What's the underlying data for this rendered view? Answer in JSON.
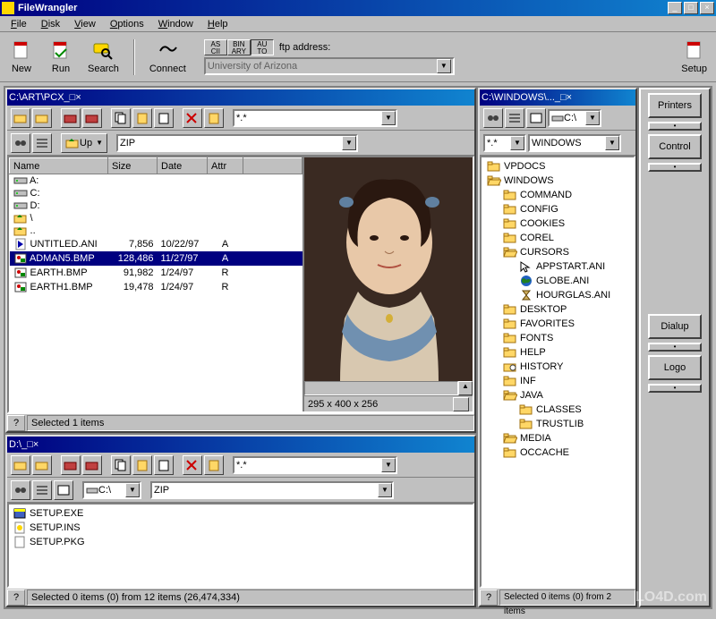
{
  "app": {
    "title": "FileWrangler"
  },
  "menu": [
    "File",
    "Disk",
    "View",
    "Options",
    "Window",
    "Help"
  ],
  "toolbar": {
    "new": "New",
    "run": "Run",
    "search": "Search",
    "connect": "Connect",
    "setup": "Setup",
    "modes": [
      "AS CII",
      "BIN ARY",
      "AU TO"
    ],
    "ftp_label": "ftp address:",
    "ftp_value": "University of Arizona"
  },
  "pane1": {
    "title": "C:\\ART\\PCX",
    "filter": "*.*",
    "compress": "ZIP",
    "up": "Up",
    "columns": [
      "Name",
      "Size",
      "Date",
      "Attr"
    ],
    "rows": [
      {
        "icon": "drive",
        "name": "A:",
        "size": "",
        "date": "",
        "attr": ""
      },
      {
        "icon": "drive",
        "name": "C:",
        "size": "",
        "date": "",
        "attr": ""
      },
      {
        "icon": "drive",
        "name": "D:",
        "size": "",
        "date": "",
        "attr": ""
      },
      {
        "icon": "back",
        "name": "\\",
        "size": "",
        "date": "",
        "attr": ""
      },
      {
        "icon": "up",
        "name": "..",
        "size": "",
        "date": "",
        "attr": ""
      },
      {
        "icon": "ani",
        "name": "UNTITLED.ANI",
        "size": "7,856",
        "date": "10/22/97",
        "attr": "A"
      },
      {
        "icon": "bmp",
        "name": "ADMAN5.BMP",
        "size": "128,486",
        "date": "11/27/97",
        "attr": "A",
        "sel": true
      },
      {
        "icon": "bmp",
        "name": "EARTH.BMP",
        "size": "91,982",
        "date": "1/24/97",
        "attr": "R"
      },
      {
        "icon": "bmp",
        "name": "EARTH1.BMP",
        "size": "19,478",
        "date": "1/24/97",
        "attr": "R"
      }
    ],
    "preview_dims": "295 x 400 x 256",
    "status": "Selected 1 items"
  },
  "pane2": {
    "title": "D:\\",
    "filter": "*.*",
    "compress": "ZIP",
    "drive": "C:\\",
    "files": [
      {
        "icon": "exe",
        "name": "SETUP.EXE"
      },
      {
        "icon": "ins",
        "name": "SETUP.INS"
      },
      {
        "icon": "pkg",
        "name": "SETUP.PKG"
      }
    ],
    "status": "Selected 0 items (0) from 12 items (26,474,334)"
  },
  "pane3": {
    "title": "C:\\WINDOWS\\...",
    "filter": "*.*",
    "drive_combo": "C:\\",
    "path": "WINDOWS",
    "tree": [
      {
        "d": 0,
        "i": "folder-closed",
        "t": "VPDOCS"
      },
      {
        "d": 0,
        "i": "folder-open",
        "t": "WINDOWS"
      },
      {
        "d": 1,
        "i": "folder-closed",
        "t": "COMMAND"
      },
      {
        "d": 1,
        "i": "folder-closed",
        "t": "CONFIG"
      },
      {
        "d": 1,
        "i": "folder-closed",
        "t": "COOKIES"
      },
      {
        "d": 1,
        "i": "folder-closed",
        "t": "COREL"
      },
      {
        "d": 1,
        "i": "folder-open",
        "t": "CURSORS"
      },
      {
        "d": 2,
        "i": "cursor",
        "t": "APPSTART.ANI"
      },
      {
        "d": 2,
        "i": "globe",
        "t": "GLOBE.ANI"
      },
      {
        "d": 2,
        "i": "hourglass",
        "t": "HOURGLAS.ANI"
      },
      {
        "d": 1,
        "i": "folder-closed",
        "t": "DESKTOP"
      },
      {
        "d": 1,
        "i": "folder-closed",
        "t": "FAVORITES"
      },
      {
        "d": 1,
        "i": "folder-closed",
        "t": "FONTS"
      },
      {
        "d": 1,
        "i": "folder-closed",
        "t": "HELP"
      },
      {
        "d": 1,
        "i": "folder-hist",
        "t": "HISTORY"
      },
      {
        "d": 1,
        "i": "folder-closed",
        "t": "INF"
      },
      {
        "d": 1,
        "i": "folder-open",
        "t": "JAVA"
      },
      {
        "d": 2,
        "i": "folder-closed",
        "t": "CLASSES"
      },
      {
        "d": 2,
        "i": "folder-closed",
        "t": "TRUSTLIB"
      },
      {
        "d": 1,
        "i": "folder-open",
        "t": "MEDIA"
      },
      {
        "d": 1,
        "i": "folder-closed",
        "t": "OCCACHE"
      }
    ],
    "status": "Selected 0 items (0) from 2 items"
  },
  "side": [
    "Printers",
    "Control",
    "Dialup",
    "Logo"
  ],
  "watermark": "LO4D.com"
}
